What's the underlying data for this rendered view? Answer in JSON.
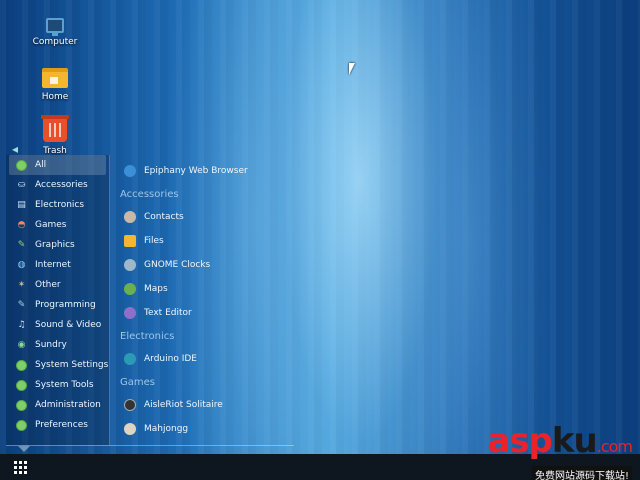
{
  "desktop": {
    "icons": [
      {
        "label": "Computer",
        "icon": "computer-icon"
      },
      {
        "label": "Home",
        "icon": "home-folder-icon"
      },
      {
        "label": "Trash",
        "icon": "trash-icon"
      }
    ]
  },
  "menu": {
    "categories": [
      {
        "label": "All",
        "icon": "all-icon"
      },
      {
        "label": "Accessories",
        "icon": "accessories-icon"
      },
      {
        "label": "Electronics",
        "icon": "electronics-icon"
      },
      {
        "label": "Games",
        "icon": "games-icon"
      },
      {
        "label": "Graphics",
        "icon": "graphics-icon"
      },
      {
        "label": "Internet",
        "icon": "internet-icon"
      },
      {
        "label": "Other",
        "icon": "other-icon"
      },
      {
        "label": "Programming",
        "icon": "programming-icon"
      },
      {
        "label": "Sound & Video",
        "icon": "sound-video-icon"
      },
      {
        "label": "Sundry",
        "icon": "sundry-icon"
      },
      {
        "label": "System Settings",
        "icon": "system-settings-icon"
      },
      {
        "label": "System Tools",
        "icon": "system-tools-icon"
      },
      {
        "label": "Administration",
        "icon": "administration-icon"
      },
      {
        "label": "Preferences",
        "icon": "preferences-icon"
      }
    ],
    "apps_top": [
      {
        "label": "Epiphany Web Browser",
        "color": "#3a8fd6"
      }
    ],
    "sections": [
      {
        "title": "Accessories",
        "apps": [
          {
            "label": "Contacts",
            "color": "#c9b8a8"
          },
          {
            "label": "Files",
            "color": "#f3b62e"
          },
          {
            "label": "GNOME Clocks",
            "color": "#9fb8c9"
          },
          {
            "label": "Maps",
            "color": "#6ab04c"
          },
          {
            "label": "Text Editor",
            "color": "#8e6fc9"
          }
        ]
      },
      {
        "title": "Electronics",
        "apps": [
          {
            "label": "Arduino IDE",
            "color": "#2b9bb5"
          }
        ]
      },
      {
        "title": "Games",
        "apps": [
          {
            "label": "AisleRiot Solitaire",
            "color": "#333333"
          },
          {
            "label": "Mahjongg",
            "color": "#e0d4c0"
          }
        ]
      }
    ]
  },
  "watermark": {
    "logo_a": "asp",
    "logo_b": "ku",
    "logo_c": ".com",
    "subtitle": "免费网站源码下载站!"
  }
}
